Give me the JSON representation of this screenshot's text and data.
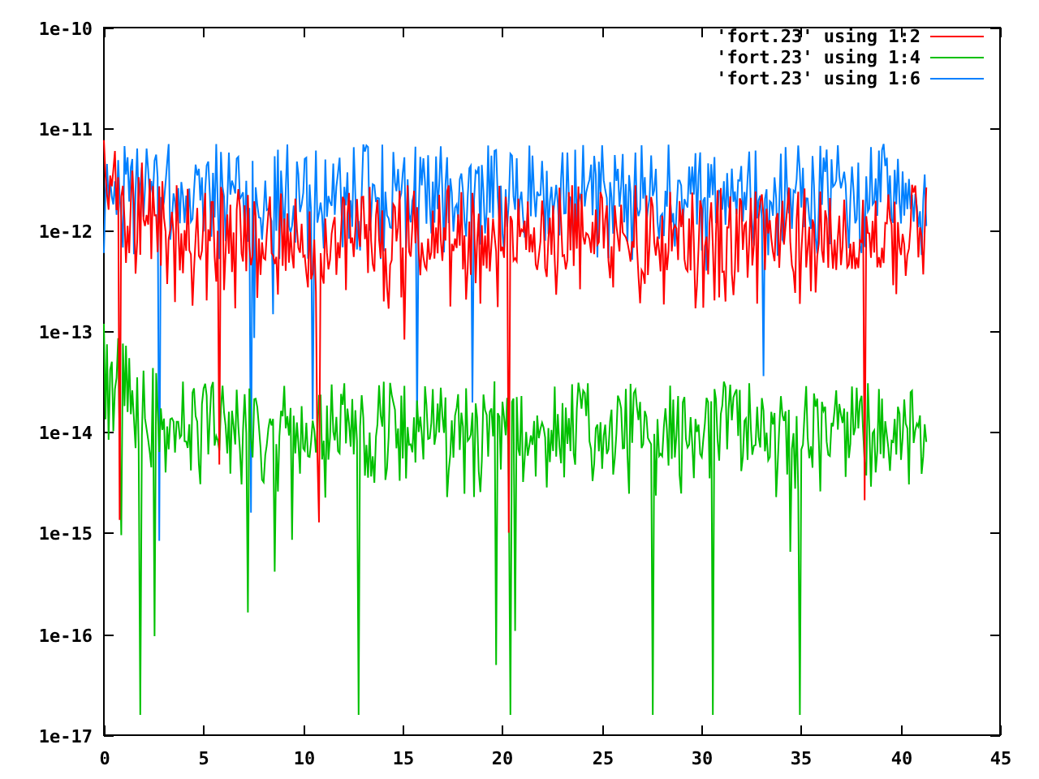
{
  "plot": {
    "y_axis_labels": [
      "1e-10",
      "1e-11",
      "1e-12",
      "1e-13",
      "1e-14",
      "1e-15",
      "1e-16",
      "1e-17"
    ],
    "x_axis_labels": [
      "0",
      "5",
      "10",
      "15",
      "20",
      "25",
      "30",
      "35",
      "40",
      "45"
    ],
    "series": [
      {
        "name": "'fort.23' using 1:2",
        "color": "#ff0000"
      },
      {
        "name": "'fort.23' using 1:4",
        "color": "#00c000"
      },
      {
        "name": "'fort.23' using 1:6",
        "color": "#0080ff"
      }
    ]
  }
}
